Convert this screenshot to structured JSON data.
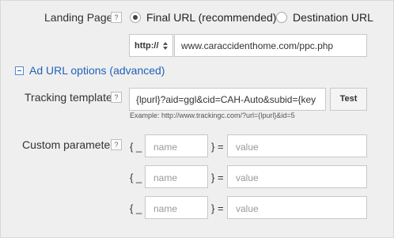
{
  "landing_page": {
    "label": "Landing Page",
    "help": "?",
    "options": [
      {
        "label": "Final URL (recommended)",
        "selected": true
      },
      {
        "label": "Destination URL",
        "selected": false
      }
    ],
    "protocol": "http://",
    "url": "www.caraccidenthome.com/ppc.php"
  },
  "ad_url_options": {
    "toggle_label": "Ad URL options (advanced)"
  },
  "tracking_template": {
    "label": "Tracking template",
    "help": "?",
    "value": "{lpurl}?aid=ggl&cid=CAH-Auto&subid={key",
    "test_label": "Test",
    "example": "Example: http://www.trackingc.com/?url={lpurl}&id=5"
  },
  "custom_parameter": {
    "label": "Custom parameter",
    "help": "?",
    "open_brace": "{ _",
    "close_eq": "} =",
    "name_placeholder": "name",
    "value_placeholder": "value",
    "rows": [
      {
        "name": "",
        "value": ""
      },
      {
        "name": "",
        "value": ""
      },
      {
        "name": "",
        "value": ""
      }
    ]
  }
}
